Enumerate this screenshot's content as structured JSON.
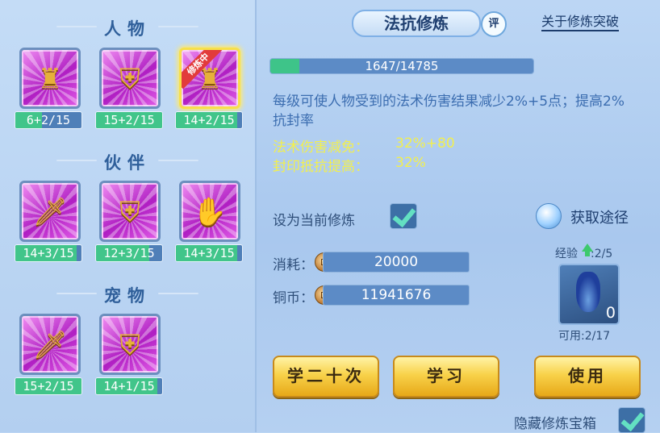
{
  "left": {
    "sections": [
      {
        "title": "人物",
        "items": [
          {
            "icon": "golden-armor-burst-icon",
            "level": "6+2/15",
            "progress": 0.4
          },
          {
            "icon": "golden-shield-warrior-icon",
            "level": "15+2/15",
            "progress": 1.0
          },
          {
            "icon": "golden-warrior-icon",
            "level": "14+2/15",
            "progress": 0.93,
            "ribbon": "修炼中",
            "selected": true
          }
        ]
      },
      {
        "title": "伙伴",
        "items": [
          {
            "icon": "sword-lion-icon",
            "level": "14+3/15",
            "progress": 0.93
          },
          {
            "icon": "shield-lion-icon",
            "level": "12+3/15",
            "progress": 0.8
          },
          {
            "icon": "claw-lion-icon",
            "level": "14+3/15",
            "progress": 0.93
          }
        ]
      },
      {
        "title": "宠物",
        "items": [
          {
            "icon": "sword-cat-icon",
            "level": "15+2/15",
            "progress": 1.0
          },
          {
            "icon": "shield-cat-icon",
            "level": "14+1/15",
            "progress": 0.93
          }
        ]
      }
    ]
  },
  "header": {
    "title": "法抗修炼",
    "badge": "评",
    "link": "关于修炼突破"
  },
  "xp": {
    "text": "1647/14785",
    "progress": 0.111
  },
  "description": "每级可使人物受到的法术伤害结果减少2%+5点；提高2%抗封率",
  "stats": [
    {
      "label": "法术伤害减免：",
      "value": "32%+80"
    },
    {
      "label": "封印抵抗提高：",
      "value": "32%"
    }
  ],
  "set_current": {
    "label": "设为当前修炼",
    "checked": true
  },
  "get_path": {
    "label": "获取途径"
  },
  "cost": {
    "label": "消耗：",
    "value": "20000"
  },
  "copper": {
    "label": "铜币：",
    "value": "11941676"
  },
  "exp_item": {
    "label": "经验",
    "value": ":2/5",
    "count": "0",
    "available": "可用:2/17"
  },
  "buttons": {
    "learn20": "学二十次",
    "learn": "学习",
    "use": "使用"
  },
  "hidden_chest": {
    "label": "隐藏修炼宝箱",
    "checked": true
  },
  "colors": {
    "highlight": "#f2ef4f",
    "progress": "#3ec489",
    "button": "#f8d24a"
  }
}
